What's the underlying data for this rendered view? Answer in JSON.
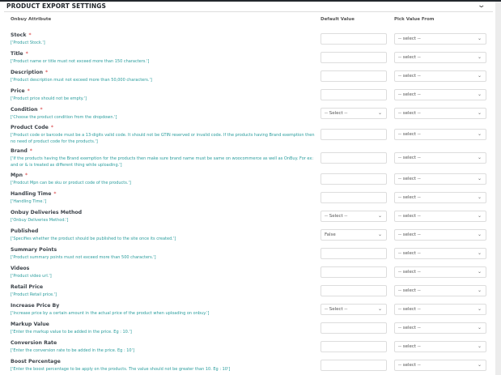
{
  "section_title": "PRODUCT EXPORT SETTINGS",
  "headers": {
    "attribute": "Onbuy Attribute",
    "default": "Default Value",
    "pick": "Pick Value From"
  },
  "pick_placeholder": "-- select --",
  "rows": [
    {
      "name": "Stock",
      "required": true,
      "desc": "['Product Stock.']",
      "default_type": "input",
      "default_value": ""
    },
    {
      "name": "Title",
      "required": true,
      "desc": "['Product name or title must not exceed more than 150 characters.']",
      "default_type": "input",
      "default_value": ""
    },
    {
      "name": "Description",
      "required": true,
      "desc": "['Product description must not exceed more than 50,000 characters.']",
      "default_type": "input",
      "default_value": ""
    },
    {
      "name": "Price",
      "required": true,
      "desc": "['Product price should not be empty.']",
      "default_type": "input",
      "default_value": ""
    },
    {
      "name": "Condition",
      "required": true,
      "desc": "['Choose the product condition from the dropdown.']",
      "default_type": "select",
      "default_value": "-- Select --"
    },
    {
      "name": "Product Code",
      "required": true,
      "desc": "['Product code or barcode must be a 13-digits valid code. It should not be GTIN reserved or invalid code. If the products having Brand exemption then no need of product code for the products.']",
      "default_type": "input",
      "default_value": ""
    },
    {
      "name": "Brand",
      "required": true,
      "desc": "['If the products having the Brand exemption for the products then make sure brand name must be same on woocommerce as well as OnBuy. For ex: and or & is treated as different thing while uploading.']",
      "default_type": "input",
      "default_value": ""
    },
    {
      "name": "Mpn",
      "required": true,
      "desc": "['Prodcut Mpn can be sku or product code of the products.']",
      "default_type": "input",
      "default_value": ""
    },
    {
      "name": "Handling Time",
      "required": true,
      "desc": "['Handling Time.']",
      "default_type": "input",
      "default_value": ""
    },
    {
      "name": "Onbuy Deliveries Method",
      "required": false,
      "desc": "['Onbuy Deliveries Method.']",
      "default_type": "select",
      "default_value": "-- Select --"
    },
    {
      "name": "Published",
      "required": false,
      "desc": "['Specifies whether the product should be published to the site once its created.']",
      "default_type": "select",
      "default_value": "False"
    },
    {
      "name": "Summary Points",
      "required": false,
      "desc": "['Product summary points must not exceed more than 500 characters.']",
      "default_type": "input",
      "default_value": ""
    },
    {
      "name": "Videos",
      "required": false,
      "desc": "['Product video url.']",
      "default_type": "input",
      "default_value": ""
    },
    {
      "name": "Retail Price",
      "required": false,
      "desc": "['Product Retail price.']",
      "default_type": "input",
      "default_value": ""
    },
    {
      "name": "Increase Price By",
      "required": false,
      "desc": "['Increase price by a certain amount in the actual price of the product when uploading on onbuy.']",
      "default_type": "select",
      "default_value": "-- Select --"
    },
    {
      "name": "Markup Value",
      "required": false,
      "desc": "['Enter the markup value to be added in the price. Eg : 10.']",
      "default_type": "input",
      "default_value": ""
    },
    {
      "name": "Conversion Rate",
      "required": false,
      "desc": "['Enter the conversion rate to be added in the price. Eg : 10']",
      "default_type": "input",
      "default_value": ""
    },
    {
      "name": "Boost Percentage",
      "required": false,
      "desc": "['Enter the boost percentage to be apply on the products. The value should not be greater than 10. Eg : 10']",
      "default_type": "input",
      "default_value": ""
    }
  ]
}
